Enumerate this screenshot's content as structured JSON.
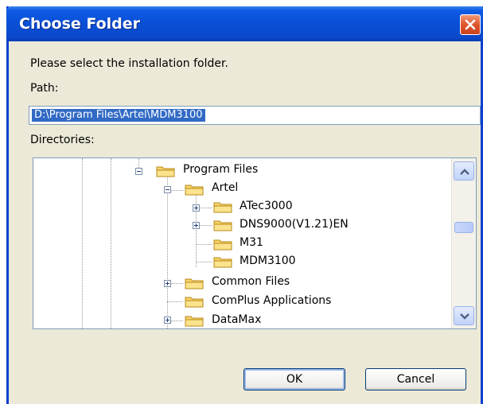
{
  "window": {
    "title": "Choose Folder"
  },
  "dialog": {
    "instruction": "Please select the installation folder.",
    "path_label": "Path:",
    "path_value": "D:\\Program Files\\Artel\\MDM3100",
    "directories_label": "Directories:"
  },
  "tree": {
    "items": [
      {
        "label": "Program Files",
        "expanded": true
      },
      {
        "label": "Artel",
        "expanded": true
      },
      {
        "label": "ATec3000",
        "expanded": false
      },
      {
        "label": "DNS9000(V1.21)EN",
        "expanded": false
      },
      {
        "label": "M31"
      },
      {
        "label": "MDM3100"
      },
      {
        "label": "Common Files",
        "expanded": false
      },
      {
        "label": "ComPlus Applications"
      },
      {
        "label": "DataMax",
        "expanded": false
      }
    ]
  },
  "buttons": {
    "ok": "OK",
    "cancel": "Cancel"
  },
  "colors": {
    "titlebar": "#0a4fd6",
    "selection": "#316ac5",
    "dialog_bg": "#ece9d8",
    "close": "#e0542c",
    "folder": "#f5d36b"
  },
  "icons": {
    "close": "close-icon",
    "folder": "folder-icon",
    "scroll_up": "scroll-up-icon",
    "scroll_down": "scroll-down-icon"
  }
}
